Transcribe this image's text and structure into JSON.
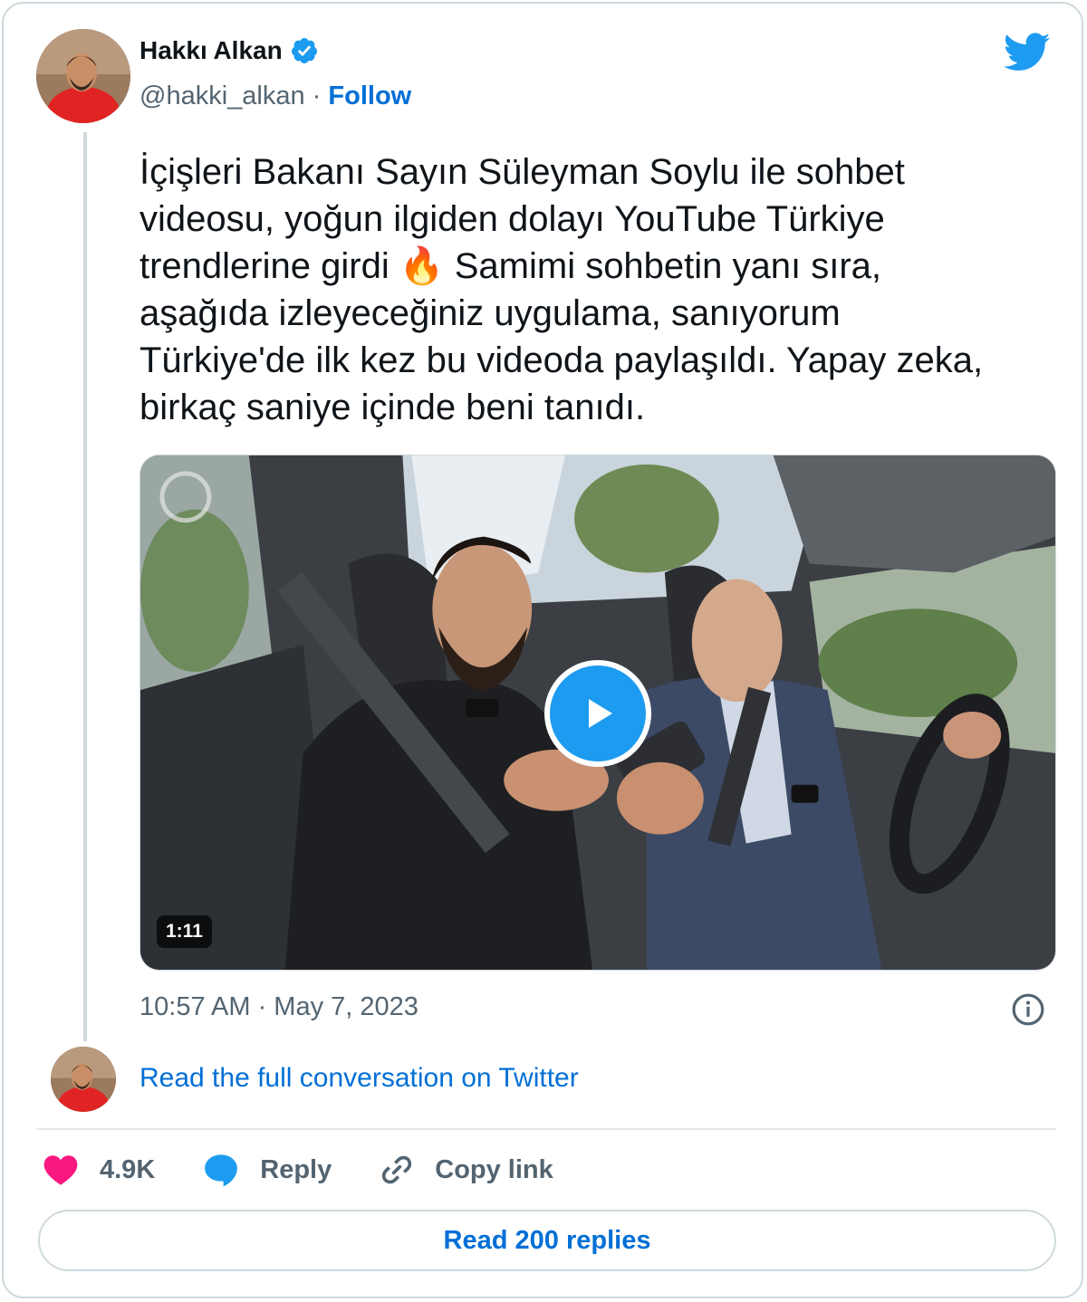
{
  "author": {
    "name": "Hakkı Alkan",
    "handle": "@hakki_alkan",
    "separator": "·",
    "follow_label": "Follow",
    "verified": true
  },
  "icons": {
    "logo": "twitter-bird-icon",
    "verified": "verified-badge-icon",
    "info": "info-icon",
    "like": "heart-icon",
    "reply": "speech-bubble-icon",
    "copy": "link-icon",
    "play": "play-icon"
  },
  "tweet": {
    "text": "İçişleri Bakanı Sayın Süleyman Soylu ile sohbet videosu, yoğun ilgiden dolayı YouTube Türkiye trendlerine girdi 🔥 Samimi sohbetin yanı sıra, aşağıda izleyeceğiniz uygulama, sanıyorum Türkiye'de ilk kez bu videoda paylaşıldı. Yapay zeka, birkaç saniye içinde beni tanıdı.",
    "timestamp": "10:57 AM · May 7, 2023"
  },
  "media": {
    "type": "video",
    "duration": "1:11"
  },
  "conversation_link": "Read the full conversation on Twitter",
  "actions": {
    "like_count": "4.9K",
    "reply_label": "Reply",
    "copy_label": "Copy link"
  },
  "read_replies_label": "Read 200 replies",
  "colors": {
    "brand": "#1d9bf0",
    "link": "#006fd6",
    "heart": "#f91880",
    "muted": "#536471",
    "text": "#0f1419"
  }
}
